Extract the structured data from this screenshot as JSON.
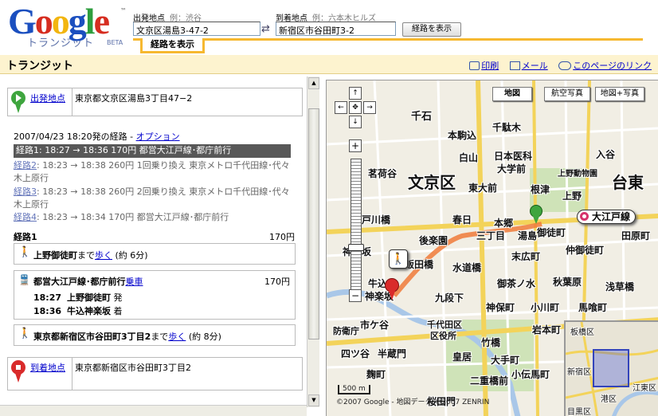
{
  "logo": {
    "google": "Google",
    "tm": "™",
    "transit": "トランジット",
    "beta": "BETA"
  },
  "search": {
    "from_label": "出発地点",
    "from_example": "例：渋谷",
    "from_value": "文京区湯島3-47-2",
    "to_label": "到着地点",
    "to_example": "例：六本木ヒルズ",
    "to_value": "新宿区市谷田町3-2",
    "swap": "⇄",
    "submit": "経路を表示",
    "tab": "経路を表示"
  },
  "titlebar": {
    "title": "トランジット",
    "print": "印刷",
    "mail": "メール",
    "link": "このページのリンク"
  },
  "origin": {
    "label": "出発地点",
    "address": "東京都文京区湯島3丁目47−2"
  },
  "header": {
    "datetime": "2007/04/23 18:20発の経路",
    "separator": "-",
    "option": "オプション"
  },
  "routes": [
    {
      "label": "経路1",
      "text": ": 18:27 → 18:36 170円 都営大江戸線･都庁前行"
    },
    {
      "label": "経路2",
      "text": ": 18:23 → 18:38 260円 1回乗り換え 東京メトロ千代田線･代々",
      "text2": "木上原行"
    },
    {
      "label": "経路3",
      "text": ": 18:23 → 18:38 260円 2回乗り換え 東京メトロ千代田線･代々",
      "text2": "木上原行"
    },
    {
      "label": "経路4",
      "text": ": 18:23 → 18:34 170円 都営大江戸線･都庁前行"
    }
  ],
  "detail": {
    "title": "経路1",
    "fare": "170円",
    "walk1": {
      "dest": "上野御徒町",
      "to": "まで",
      "walk": "歩く",
      "dur": "(約 6分)"
    },
    "train": {
      "name": "都営大江戸線･都庁前行",
      "link": "乗車",
      "fare": "170円",
      "dep_time": "18:27",
      "dep_station": "上野御徒町",
      "dep_mark": "発",
      "arr_time": "18:36",
      "arr_station": "牛込神楽坂",
      "arr_mark": "着"
    },
    "walk2": {
      "dest": "東京都新宿区市谷田町3丁目2",
      "to": "まで",
      "walk": "歩く",
      "dur": "(約 8分)"
    }
  },
  "destination": {
    "label": "到着地点",
    "address": "東京都新宿区市谷田町3丁目2"
  },
  "map": {
    "btn_map": "地図",
    "btn_sat": "航空写真",
    "btn_hyb": "地図+写真",
    "pan_up": "↑",
    "pan_left": "←",
    "pan_center": "✥",
    "pan_right": "→",
    "pan_down": "↓",
    "zoom_in": "+",
    "zoom_out": "−",
    "labels": {
      "a": "千石",
      "b": "本駒込",
      "c": "千駄木",
      "d": "白山",
      "e": "日本医科",
      "f": "大学前",
      "g": "入谷",
      "h": "茗荷谷",
      "i": "文京区",
      "j": "東大前",
      "k": "根津",
      "l": "上野動物園",
      "m": "台東",
      "n": "戸川橋",
      "o": "春日",
      "p": "本郷",
      "q": "三丁目",
      "r": "湯島",
      "s": "上野",
      "t": "御徒町",
      "u": "大江戸線",
      "v": "田原町",
      "w": "後楽園",
      "x": "神楽坂",
      "y": "飯田橋",
      "z": "水道橋",
      "aa": "末広町",
      "ab": "仲御徒町",
      "ac": "牛込",
      "ad": "神楽坂",
      "ae": "九段下",
      "af": "御茶ノ水",
      "ag": "秋葉原",
      "ah": "浅草橋",
      "ai": "市ケ谷",
      "aj": "千代田区",
      "ak": "区役所",
      "al": "神保町",
      "am": "小川町",
      "an": "馬喰町",
      "ao": "四ツ谷",
      "ap": "半蔵門",
      "aq": "皇居",
      "ar": "竹橋",
      "as": "大手町",
      "at": "二重橋前",
      "au": "桜田門",
      "av": "防衛庁",
      "aw": "麹町",
      "ax": "岩本町",
      "ay": "小伝馬町"
    },
    "ov_labels": {
      "a": "板橋区",
      "b": "新宿区",
      "c": "港区",
      "d": "目黒区",
      "e": "江東区"
    },
    "credit": "©2007 Google - 地図データ ©2007 ZENRIN",
    "scale": "500 m"
  }
}
